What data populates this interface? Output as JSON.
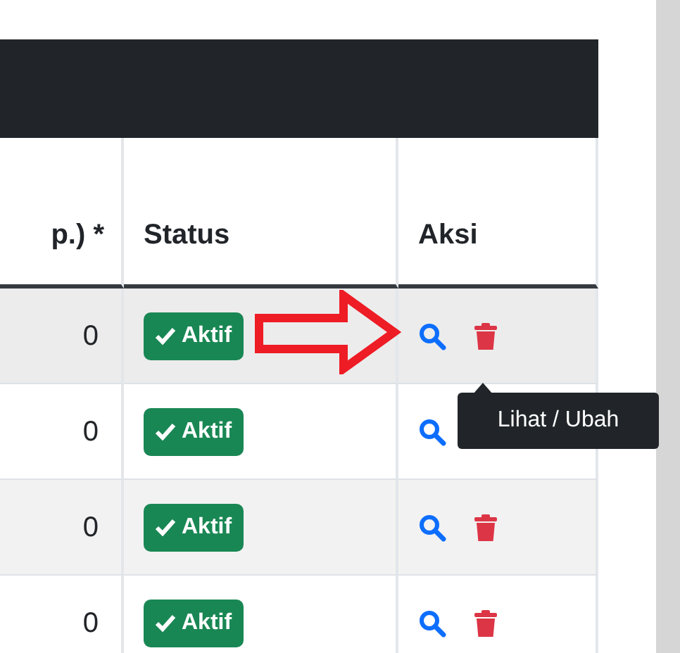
{
  "table": {
    "columns": [
      "p.) *",
      "Status",
      "Aksi"
    ],
    "rows": [
      {
        "value": "0",
        "status": "Aktif",
        "actions": [
          {
            "kind": "view"
          },
          {
            "kind": "delete"
          }
        ]
      },
      {
        "value": "0",
        "status": "Aktif",
        "actions": [
          {
            "kind": "view"
          }
        ]
      },
      {
        "value": "0",
        "status": "Aktif",
        "actions": [
          {
            "kind": "view"
          },
          {
            "kind": "delete"
          }
        ]
      },
      {
        "value": "0",
        "status": "Aktif",
        "actions": [
          {
            "kind": "view"
          },
          {
            "kind": "delete"
          }
        ]
      }
    ]
  },
  "annotation": {
    "kind": "arrow"
  },
  "tooltip": {
    "text": "Lihat / Ubah"
  }
}
